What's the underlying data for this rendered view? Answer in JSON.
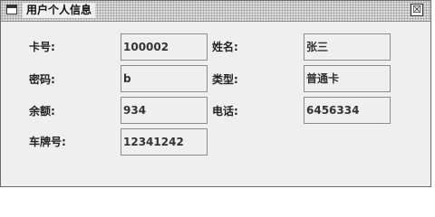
{
  "window": {
    "title": "用户个人信息",
    "close_symbol": "☒"
  },
  "form": {
    "card_no": {
      "label": "卡号:",
      "value": "100002"
    },
    "name": {
      "label": "姓名:",
      "value": "张三"
    },
    "password": {
      "label": "密码:",
      "value": "b"
    },
    "type": {
      "label": "类型:",
      "value": "普通卡"
    },
    "balance": {
      "label": "余额:",
      "value": "934"
    },
    "phone": {
      "label": "电话:",
      "value": "6456334"
    },
    "plate": {
      "label": "车牌号:",
      "value": "12341242"
    }
  }
}
